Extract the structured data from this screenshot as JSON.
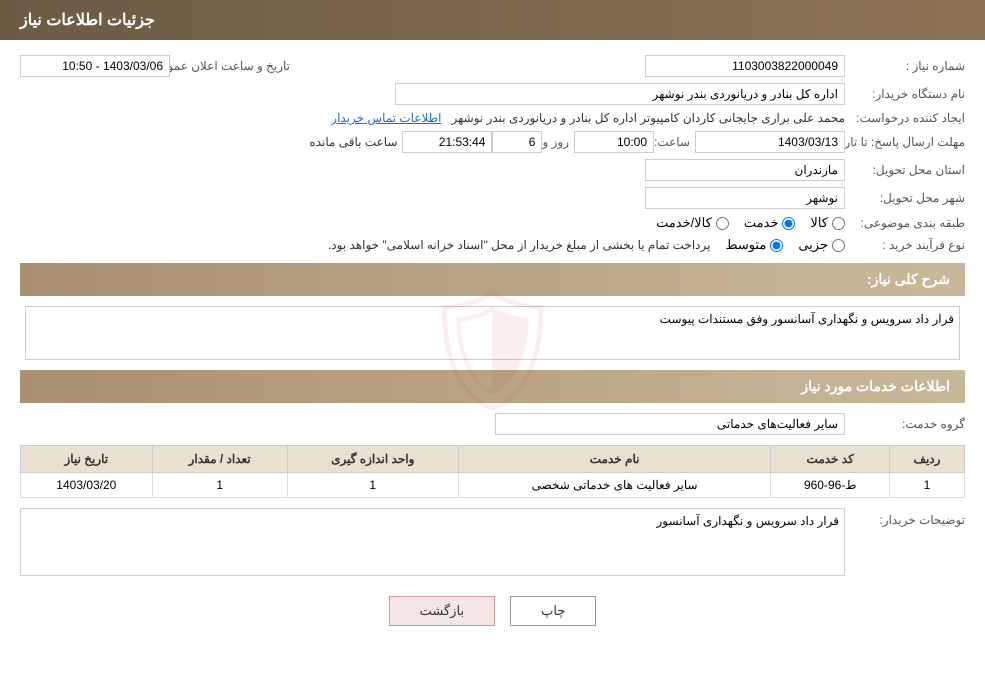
{
  "page": {
    "title": "جزئیات اطلاعات نیاز",
    "header_text": "جزئیات اطلاعات نیاز"
  },
  "fields": {
    "request_number_label": "شماره نیاز :",
    "request_number_value": "1103003822000049",
    "org_label": "نام دستگاه خریدار:",
    "org_value": "اداره کل بنادر و دریانوردی بندر نوشهر",
    "announce_date_label": "تاریخ و ساعت اعلان عمومی:",
    "announce_date_value": "1403/03/06 - 10:50",
    "creator_label": "ایجاد کننده درخواست:",
    "creator_value": "محمد علی براری جایجانی کاردان کامپیوتر اداره کل بنادر و دریانوردی بندر نوشهر",
    "contact_link": "اطلاعات تماس خریدار",
    "deadline_label": "مهلت ارسال پاسخ: تا تاریخ:",
    "deadline_date": "1403/03/13",
    "deadline_time_label": "ساعت:",
    "deadline_time": "10:00",
    "deadline_day_label": "روز و",
    "deadline_days": "6",
    "deadline_remaining_label": "ساعت باقی مانده",
    "deadline_remaining": "21:53:44",
    "province_label": "استان محل تحویل:",
    "province_value": "مازندران",
    "city_label": "شهر محل تحویل:",
    "city_value": "نوشهر",
    "category_label": "طبقه بندی موضوعی:",
    "category_kala": "کالا",
    "category_khedmat": "خدمت",
    "category_kala_khedmat": "کالا/خدمت",
    "purchase_type_label": "نوع فرآیند خرید :",
    "purchase_type_jozi": "جزیی",
    "purchase_type_motavaset": "متوسط",
    "purchase_note": "پرداخت تمام یا بخشی از مبلغ خریدار از محل \"اسناد خزانه اسلامی\" خواهد بود.",
    "description_label": "شرح کلی نیاز:",
    "description_value": "قرار داد سرویس و نگهداری آسانسور وفق مستندات پیوست",
    "services_section_label": "اطلاعات خدمات مورد نیاز",
    "service_group_label": "گروه خدمت:",
    "service_group_value": "سایر فعالیت‌های خدماتی",
    "table_headers": [
      "ردیف",
      "کد خدمت",
      "نام خدمت",
      "واحد اندازه گیری",
      "تعداد / مقدار",
      "تاریخ نیاز"
    ],
    "table_rows": [
      {
        "row": "1",
        "code": "ط-96-960",
        "name": "سایر فعالیت های خدماتی شخصی",
        "unit": "1",
        "quantity": "1",
        "date": "1403/03/20"
      }
    ],
    "buyer_desc_label": "توضیحات خریدار:",
    "buyer_desc_value": "قرار داد سرویس و نگهداری آسانسور",
    "btn_print": "چاپ",
    "btn_back": "بازگشت"
  }
}
